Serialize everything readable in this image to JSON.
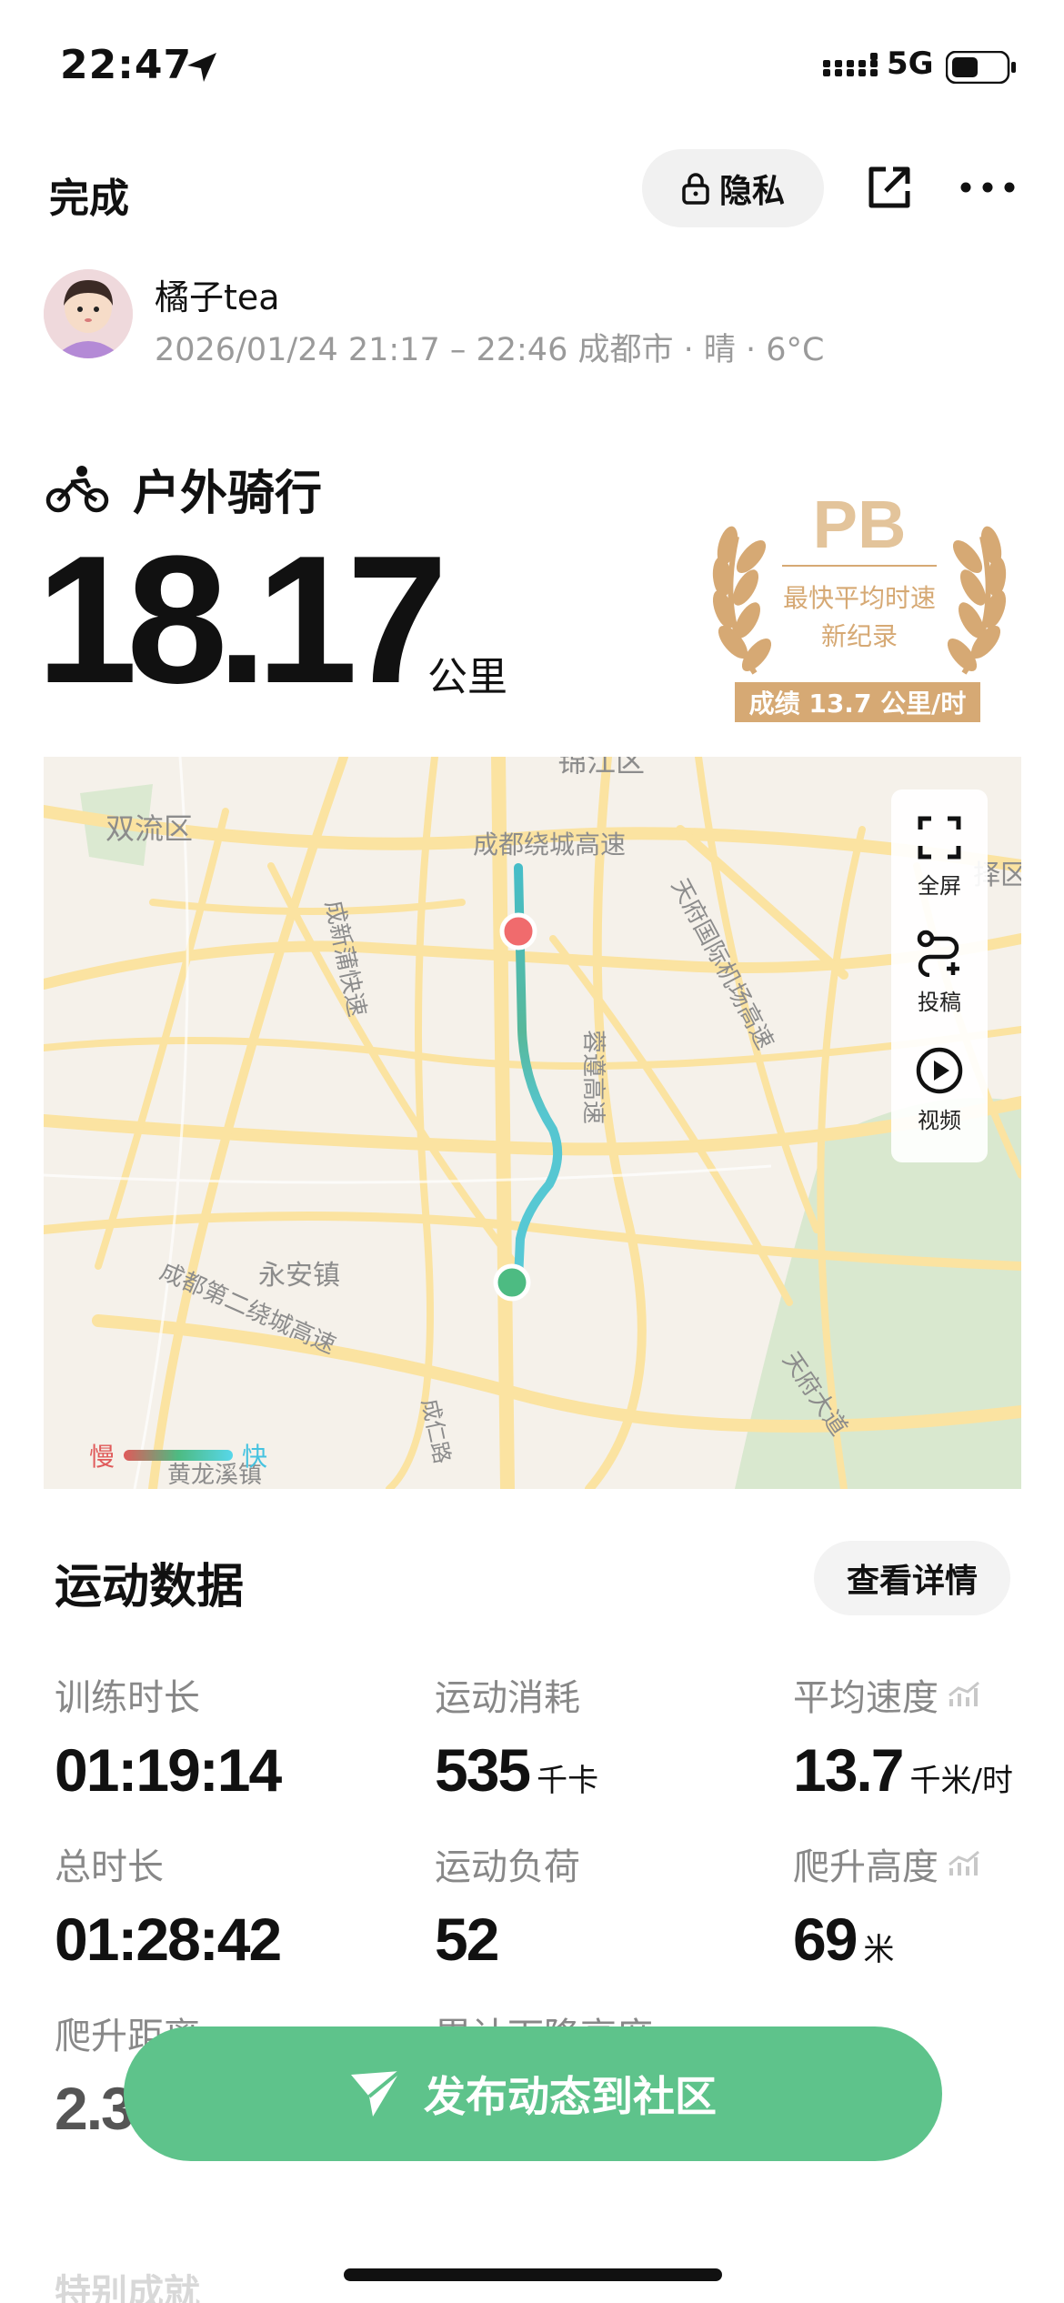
{
  "status_bar": {
    "time": "22:47",
    "network": "5G"
  },
  "header": {
    "done_label": "完成",
    "privacy_label": "隐私"
  },
  "user": {
    "name": "橘子tea",
    "meta": "2026/01/24 21:17 – 22:46 成都市 · 晴 · 6°C"
  },
  "activity": {
    "type": "户外骑行",
    "distance": "18.17",
    "unit": "公里"
  },
  "pb": {
    "title": "PB",
    "line1": "最快平均时速",
    "line2": "新纪录",
    "result": "成绩 13.7 公里/时"
  },
  "map": {
    "labels": [
      "锦江区",
      "双流区",
      "成都绕城高速",
      "天府国际机场高速",
      "成新蒲快速",
      "蓉遵高速",
      "永安镇",
      "成都第二绕城高速",
      "成仁路",
      "黄龙溪镇",
      "天府大道",
      "择区"
    ],
    "tools": [
      {
        "label": "全屏",
        "icon": "fullscreen-icon"
      },
      {
        "label": "投稿",
        "icon": "route-submit-icon"
      },
      {
        "label": "视频",
        "icon": "play-icon"
      }
    ],
    "legend": {
      "slow": "慢",
      "fast": "快"
    },
    "colors": {
      "start": "#f06b6d",
      "end": "#4dbb82",
      "route": "#57c9d6"
    }
  },
  "sports_data": {
    "title": "运动数据",
    "detail_label": "查看详情",
    "metrics": [
      {
        "label": "训练时长",
        "value": "01:19:14",
        "unit": ""
      },
      {
        "label": "运动消耗",
        "value": "535",
        "unit": "千卡"
      },
      {
        "label": "平均速度",
        "value": "13.7",
        "unit": "千米/时"
      },
      {
        "label": "总时长",
        "value": "01:28:42",
        "unit": ""
      },
      {
        "label": "运动负荷",
        "value": "52",
        "unit": ""
      },
      {
        "label": "爬升高度",
        "value": "69",
        "unit": "米"
      },
      {
        "label": "爬升距离",
        "value": "2.3",
        "unit": ""
      },
      {
        "label": "累计下降高度",
        "value": "",
        "unit": ""
      }
    ]
  },
  "publish": {
    "label": "发布动态到社区"
  },
  "next_section_title": "特别成就"
}
